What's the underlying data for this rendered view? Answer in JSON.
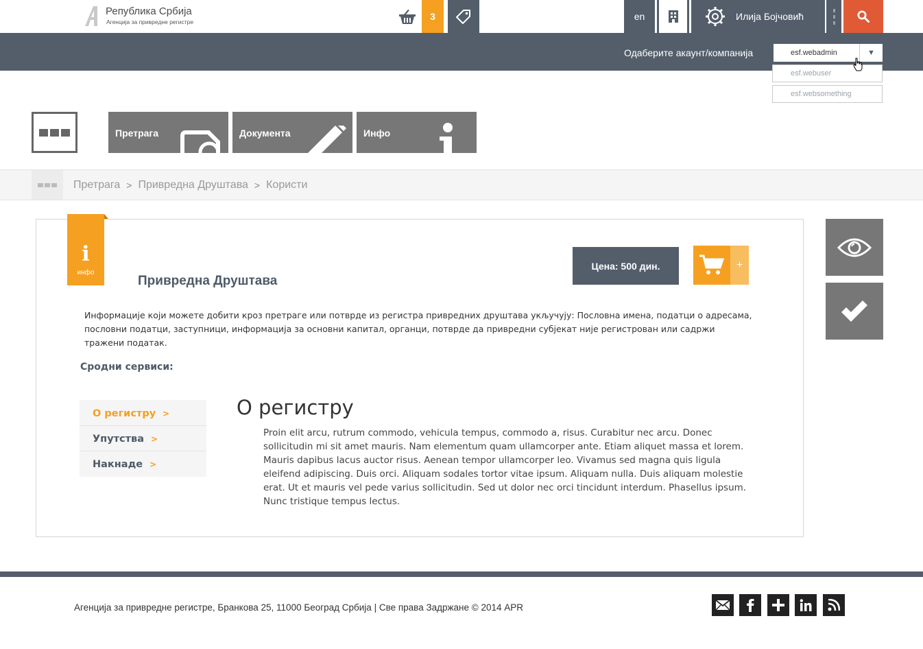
{
  "header": {
    "logo_title": "Република Србија",
    "logo_subtitle": "Агенција за привредне регистре",
    "cart_count": "3",
    "language": "en",
    "user_name": "Илија Бојчовић"
  },
  "account": {
    "label": "Одаберите акаунт/компанија",
    "selected": "esf.webadmin",
    "options": [
      "esf.webuser",
      "esf.websomething"
    ]
  },
  "tiles": {
    "search": "Претрага",
    "documents": "Документа",
    "info": "Инфо"
  },
  "breadcrumb": [
    "Претрага",
    "Привредна Друштава",
    "Користи"
  ],
  "card": {
    "ribbon_label": "инфо",
    "ribbon_glyph": "i",
    "title": "Привредна Друштава",
    "price": "Цена: 500 дин.",
    "add_plus": "+",
    "description": "Информације који можете добити кроз претраге или потврде из регистра привредних друштава укључују: Пословна имена, податци о адресама, пословни податци, заступници, информација за основни капитал, органци, потврде да привредни субјекат није регистрован или садржи тражени податак.",
    "related_label": "Сродни сервиси:",
    "menu": [
      "О регистру",
      "Упутства",
      "Накнаде"
    ],
    "section_title": "О регистру",
    "section_body": "Proin elit arcu, rutrum commodo, vehicula tempus, commodo a, risus. Curabitur nec arcu. Donec sollicitudin mi sit amet mauris. Nam elementum quam ullamcorper ante. Etiam aliquet massa et lorem. Mauris dapibus lacus auctor risus. Aenean tempor ullamcorper leo. Vivamus sed magna quis ligula eleifend adipiscing. Duis orci. Aliquam sodales tortor vitae ipsum. Aliquam nulla. Duis aliquam molestie erat. Ut et mauris vel pede varius sollicitudin. Sed ut dolor nec orci tincidunt interdum. Phasellus ipsum. Nunc tristique tempus lectus."
  },
  "footer": {
    "text": "Агенција за привредне регистре, Бранкова 25, 11000 Београд Србија | Све права Задржане © 2014 APR"
  },
  "colors": {
    "slate": "#545e6b",
    "orange": "#f5a020",
    "red": "#e05a36",
    "tile_gray": "#777777"
  },
  "icons": [
    "basket-icon",
    "tag-icon",
    "building-icon",
    "gear-icon",
    "search-icon",
    "eye-icon",
    "check-icon",
    "email-icon",
    "facebook-icon",
    "plus-icon",
    "linkedin-icon",
    "rss-icon"
  ]
}
